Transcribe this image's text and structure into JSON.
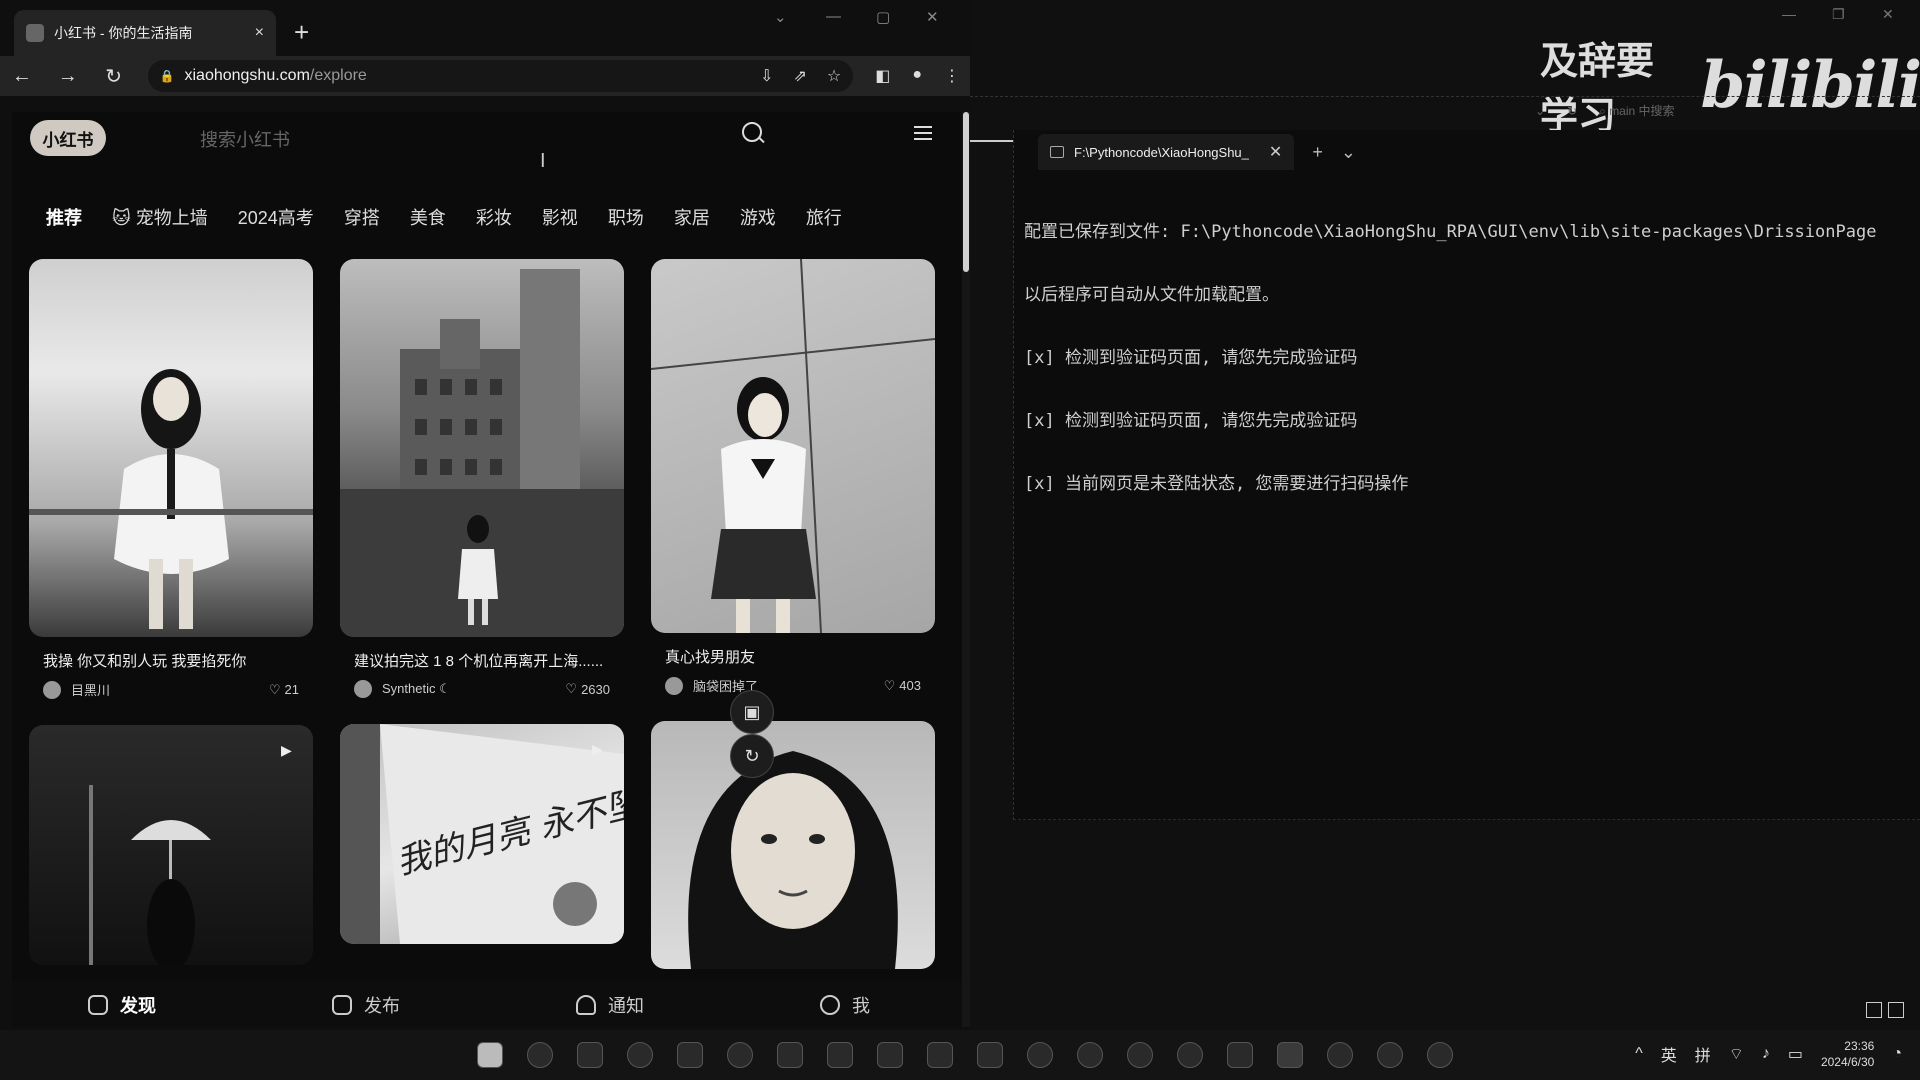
{
  "browser": {
    "tab_title": "小红书 - 你的生活指南",
    "tab_close": "×",
    "new_tab": "+",
    "url_host": "xiaohongshu.com",
    "url_path": "/explore",
    "nav_back": "←",
    "nav_forward": "→",
    "nav_reload": "↻"
  },
  "xhs": {
    "logo": "小红书",
    "search_placeholder": "搜索小红书",
    "channels": [
      "推荐",
      "🐱 宠物上墙",
      "2024高考",
      "穿搭",
      "美食",
      "彩妆",
      "影视",
      "职场",
      "家居",
      "游戏",
      "旅行"
    ],
    "cards": [
      {
        "title": "我操 你又和别人玩 我要掐死你",
        "author": "目黑川",
        "likes": "21"
      },
      {
        "title": "建议拍完这 1 8 个机位再离开上海......",
        "author": "Synthetic ☾",
        "likes": "2630"
      },
      {
        "title": "真心找男朋友",
        "author": "脑袋困掉了",
        "likes": "403"
      }
    ],
    "book_text": "我的月亮 永不坠落",
    "bottom_nav": {
      "discover": "发现",
      "publish": "发布",
      "notify": "通知",
      "me": "我"
    }
  },
  "watermark": {
    "text": "及辞要学习",
    "logo": "bilibili"
  },
  "vscode": {
    "search": "main 中搜索"
  },
  "terminal": {
    "tab_title": "F:\\Pythoncode\\XiaoHongShu_",
    "lines": [
      "配置已保存到文件: F:\\Pythoncode\\XiaoHongShu_RPA\\GUI\\env\\lib\\site-packages\\DrissionPage",
      "以后程序可自动从文件加载配置。",
      "[x] 检测到验证码页面, 请您先完成验证码",
      "[x] 检测到验证码页面, 请您先完成验证码",
      "[x] 当前网页是未登陆状态, 您需要进行扫码操作"
    ]
  },
  "taskbar": {
    "lang_en": "英",
    "lang_pinyin": "拼",
    "time": "23:36",
    "date": "2024/6/30"
  },
  "icons": [
    "search-icon",
    "menu-icon",
    "heart-icon",
    "home-icon",
    "plus-icon",
    "bell-icon",
    "user-icon",
    "image-icon",
    "refresh-icon",
    "windows-start-icon"
  ]
}
